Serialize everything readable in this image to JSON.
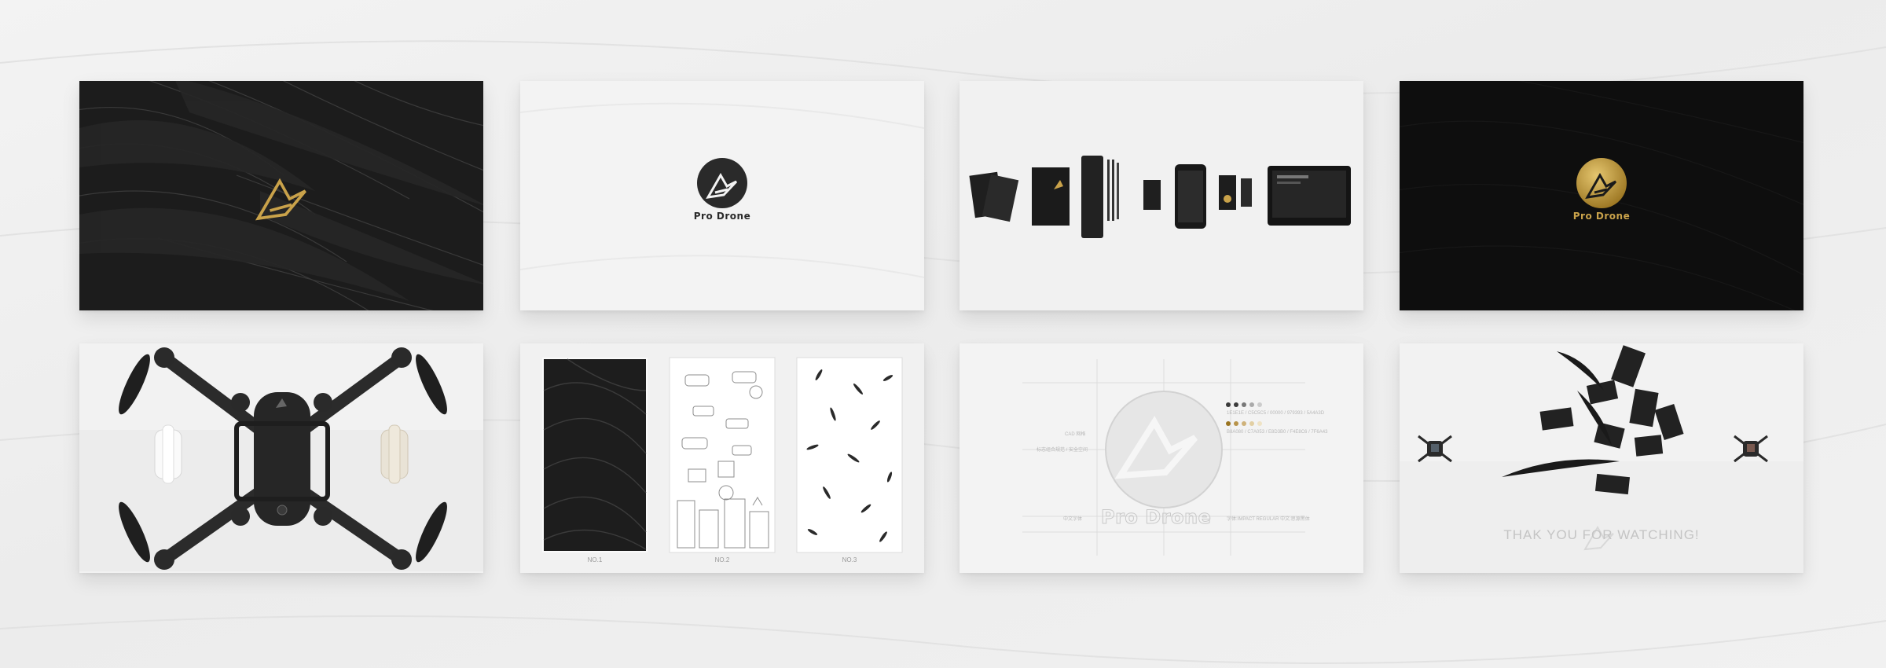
{
  "brand": {
    "name": "Pro Drone"
  },
  "patterns": {
    "labels": [
      "NO.1",
      "NO.2",
      "NO.3"
    ]
  },
  "spec": {
    "color_codes": [
      "1E1E1E / C5C5C5 / 00000 / 979393 / 5A4A3D",
      "B8A080 / C7A053 / E8D3B0 / F4E8C6 / 7F6A43"
    ],
    "labels": [
      "CAD 网格",
      "字体:IMPACT REGULAR 中文:思源黑体",
      "中文字体",
      "标志组合规范 / 安全空间"
    ]
  },
  "closing": {
    "text": "THAK YOU FOR WATCHING!"
  },
  "colors": {
    "gold": "#c9a24a",
    "dark": "#1e1e1e",
    "black": "#0e0e0e",
    "light": "#f3f3f3"
  },
  "icons": [
    "drone-logo-icon"
  ]
}
